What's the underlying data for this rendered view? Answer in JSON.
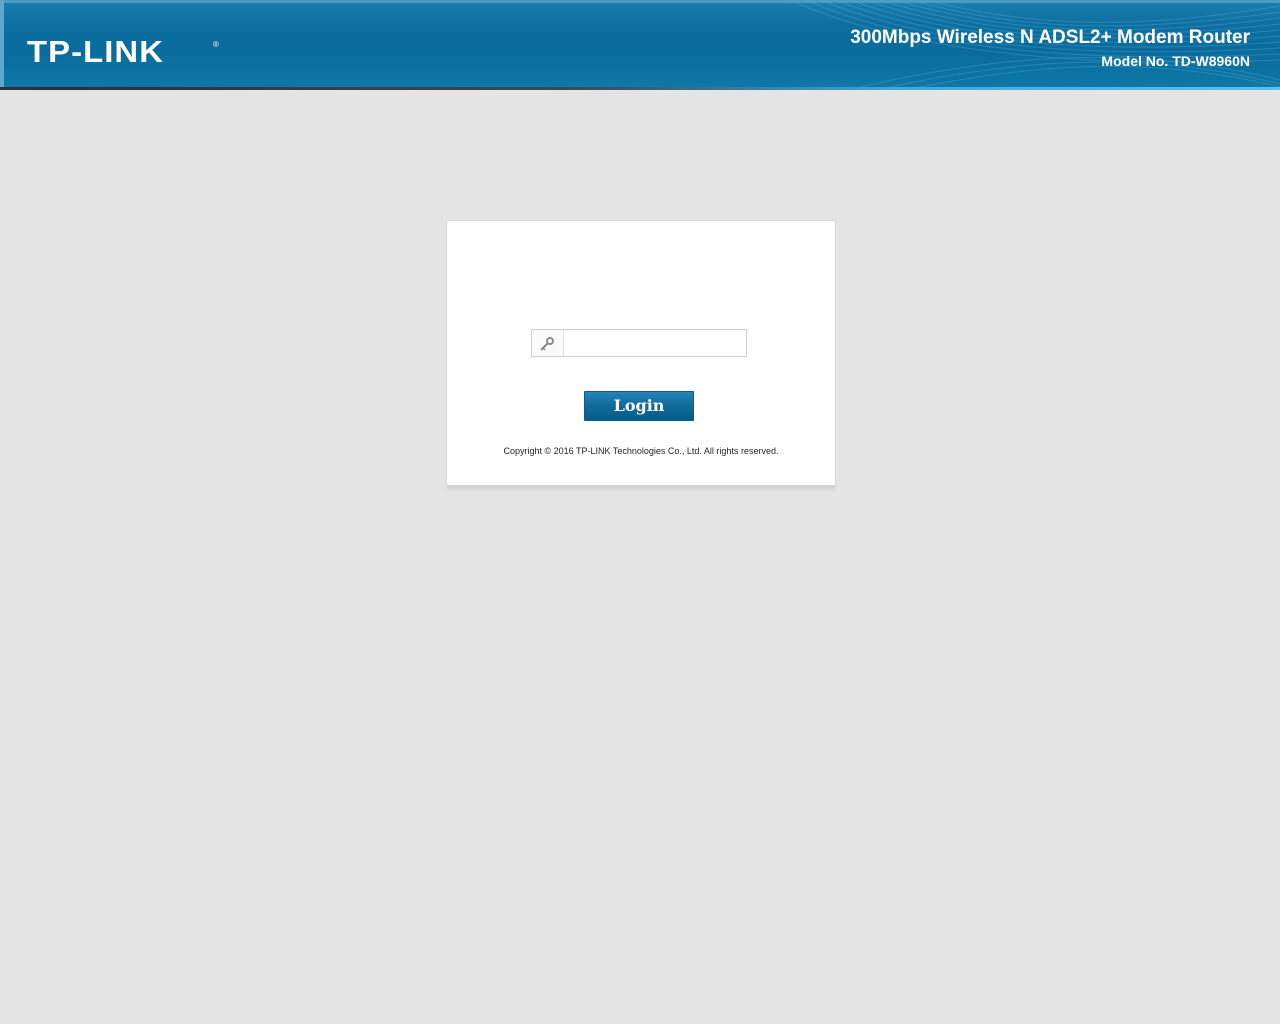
{
  "header": {
    "logo_text": "TP-LINK",
    "logo_reg": "®",
    "product_name": "300Mbps Wireless N ADSL2+ Modem Router",
    "model_no": "Model No. TD-W8960N"
  },
  "login": {
    "password_value": "",
    "password_icon": "key-icon",
    "button_label": "Login",
    "copyright": "Copyright © 2016 TP-LINK Technologies Co., Ltd. All rights reserved."
  },
  "colors": {
    "header_blue": "#0a6c9c",
    "button_blue": "#0f6a9a",
    "page_background": "#e4e4e4"
  }
}
